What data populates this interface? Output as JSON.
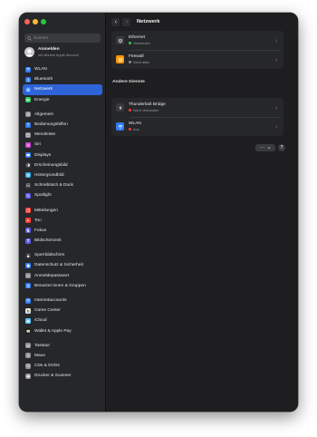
{
  "window": {
    "title": "Netzwerk"
  },
  "search": {
    "placeholder": "Suchen"
  },
  "account": {
    "title": "Anmelden",
    "subtitle": "mit deinem Apple Account"
  },
  "sidebar": {
    "groups": [
      [
        {
          "label": "WLAN",
          "icon": "wifi-icon",
          "color": "#2f7cf6"
        },
        {
          "label": "Bluetooth",
          "icon": "bluetooth-icon",
          "color": "#2f7cf6"
        },
        {
          "label": "Netzwerk",
          "icon": "globe-icon",
          "color": "#2f7cf6",
          "active": true
        },
        {
          "label": "Energie",
          "icon": "battery-icon",
          "color": "#34c759"
        }
      ],
      [
        {
          "label": "Allgemein",
          "icon": "gear-icon",
          "color": "#8e8e93"
        },
        {
          "label": "Bedienungshilfen",
          "icon": "accessibility-icon",
          "color": "#2f7cf6"
        },
        {
          "label": "Menüleiste",
          "icon": "menubar-icon",
          "color": "#8e8e93"
        },
        {
          "label": "Siri",
          "icon": "siri-icon",
          "color": "#c34dd6"
        },
        {
          "label": "Displays",
          "icon": "display-icon",
          "color": "#2f7cf6"
        },
        {
          "label": "Erscheinungsbild",
          "icon": "appearance-icon",
          "color": "#3a3a3c"
        },
        {
          "label": "Hintergrundbild",
          "icon": "wallpaper-icon",
          "color": "#32ade6"
        },
        {
          "label": "Schreibtisch & Dock",
          "icon": "dock-icon",
          "color": "#3a3a3c"
        },
        {
          "label": "Spotlight",
          "icon": "spotlight-icon",
          "color": "#5e5ce6"
        }
      ],
      [
        {
          "label": "Mitteilungen",
          "icon": "notifications-icon",
          "color": "#ff3b30"
        },
        {
          "label": "Ton",
          "icon": "sound-icon",
          "color": "#ff3b30"
        },
        {
          "label": "Fokus",
          "icon": "focus-icon",
          "color": "#5e5ce6"
        },
        {
          "label": "Bildschirmzeit",
          "icon": "screentime-icon",
          "color": "#5e5ce6"
        }
      ],
      [
        {
          "label": "Sperrbildschirm",
          "icon": "lockscreen-icon",
          "color": "#3a3a3c"
        },
        {
          "label": "Datenschutz & Sicherheit",
          "icon": "privacy-icon",
          "color": "#2f7cf6"
        },
        {
          "label": "Anmeldepasswort",
          "icon": "password-icon",
          "color": "#8e8e93"
        },
        {
          "label": "Benutzer:innen & Gruppen",
          "icon": "users-icon",
          "color": "#2f7cf6"
        }
      ],
      [
        {
          "label": "Internetaccounts",
          "icon": "at-icon",
          "color": "#2f7cf6"
        },
        {
          "label": "Game Center",
          "icon": "gamecenter-icon",
          "color": "#e5e5ea"
        },
        {
          "label": "iCloud",
          "icon": "icloud-icon",
          "color": "#5ac8fa"
        },
        {
          "label": "Wallet & Apple Pay",
          "icon": "wallet-icon",
          "color": "#1c1c1e"
        }
      ],
      [
        {
          "label": "Tastatur",
          "icon": "keyboard-icon",
          "color": "#8e8e93"
        },
        {
          "label": "Maus",
          "icon": "mouse-icon",
          "color": "#8e8e93"
        },
        {
          "label": "CDs & DVDs",
          "icon": "disc-icon",
          "color": "#8e8e93"
        },
        {
          "label": "Drucker & Scanner",
          "icon": "printer-icon",
          "color": "#8e8e93"
        }
      ]
    ]
  },
  "services_top": [
    {
      "name": "Ethernet",
      "status": "Verbunden",
      "status_color": "#34c759",
      "icon": "ethernet-icon",
      "icon_color": "#3a3a3c"
    },
    {
      "name": "Firewall",
      "status": "Nicht aktiv",
      "status_color": "#8e8e93",
      "icon": "firewall-icon",
      "icon_color": "#ff9500"
    }
  ],
  "other_services": {
    "heading": "Andere Dienste",
    "items": [
      {
        "name": "Thunderbolt Bridge",
        "status": "Nicht verbunden",
        "status_color": "#ff3b30",
        "icon": "thunderbolt-icon",
        "icon_color": "#3a3a3c"
      },
      {
        "name": "WLAN",
        "status": "Aus",
        "status_color": "#ff3b30",
        "icon": "wifi-icon",
        "icon_color": "#2f7cf6"
      }
    ]
  },
  "actions": {
    "more": "···",
    "help": "?"
  }
}
